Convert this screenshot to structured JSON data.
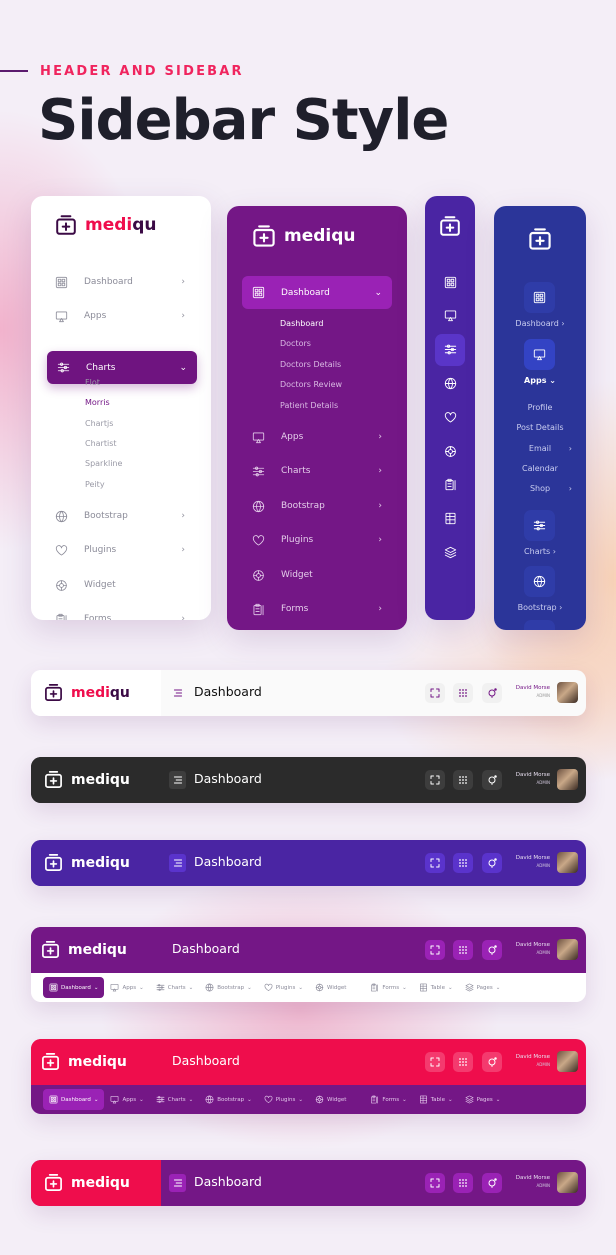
{
  "hero": {
    "kicker": "HEADER AND SIDEBAR",
    "title": "Sidebar Style"
  },
  "brand": {
    "name_a": "medi",
    "name_b": "qu",
    "full": "mediqu"
  },
  "colors": {
    "purple": "#741786",
    "purple_active": "#9a22b5",
    "indigo": "#4a25a3",
    "navy": "#2b3599",
    "red": "#ef0d4c",
    "dark": "#2b2b2b",
    "accent_pink": "#f0245e"
  },
  "sidebar_light": {
    "items": [
      {
        "label": "Dashboard",
        "icon": "dashboard-icon",
        "chev": "›"
      },
      {
        "label": "Apps",
        "icon": "monitor-icon",
        "chev": "›"
      },
      {
        "label": "Charts",
        "icon": "sliders-icon",
        "chev": "⌄",
        "active": true
      },
      {
        "label": "Bootstrap",
        "icon": "globe-icon",
        "chev": "›"
      },
      {
        "label": "Plugins",
        "icon": "heart-icon",
        "chev": "›"
      },
      {
        "label": "Widget",
        "icon": "gear-icon",
        "chev": ""
      },
      {
        "label": "Forms",
        "icon": "clipboard-icon",
        "chev": "›"
      }
    ],
    "submenu": [
      {
        "label": "Flot"
      },
      {
        "label": "Morris",
        "active": true
      },
      {
        "label": "Chartjs"
      },
      {
        "label": "Chartist"
      },
      {
        "label": "Sparkline"
      },
      {
        "label": "Peity"
      }
    ]
  },
  "sidebar_purple": {
    "items": [
      {
        "label": "Dashboard",
        "icon": "dashboard-icon",
        "chev": "⌄",
        "active": true
      },
      {
        "label": "Apps",
        "icon": "monitor-icon",
        "chev": "›"
      },
      {
        "label": "Charts",
        "icon": "sliders-icon",
        "chev": "›"
      },
      {
        "label": "Bootstrap",
        "icon": "globe-icon",
        "chev": "›"
      },
      {
        "label": "Plugins",
        "icon": "heart-icon",
        "chev": "›"
      },
      {
        "label": "Widget",
        "icon": "gear-icon",
        "chev": ""
      },
      {
        "label": "Forms",
        "icon": "clipboard-icon",
        "chev": "›"
      }
    ],
    "submenu": [
      {
        "label": "Dashboard",
        "active": true
      },
      {
        "label": "Doctors"
      },
      {
        "label": "Doctors Details"
      },
      {
        "label": "Doctors Review"
      },
      {
        "label": "Patient Details"
      }
    ]
  },
  "sidebar_mini": {
    "icons": [
      "dashboard-icon",
      "monitor-icon",
      "sliders-icon",
      "globe-icon",
      "heart-icon",
      "gear-icon",
      "clipboard-icon",
      "table-icon",
      "layers-icon"
    ],
    "active_index": 2
  },
  "sidebar_compact": {
    "items": [
      {
        "label": "Dashboard",
        "icon": "dashboard-icon",
        "chev": "›"
      },
      {
        "label": "Apps",
        "icon": "monitor-icon",
        "chev": "⌄",
        "active": true
      },
      {
        "label": "Charts",
        "icon": "sliders-icon",
        "chev": "›"
      },
      {
        "label": "Bootstrap",
        "icon": "globe-icon",
        "chev": "›"
      }
    ],
    "submenu": [
      {
        "label": "Profile",
        "chev": ""
      },
      {
        "label": "Post Details",
        "chev": ""
      },
      {
        "label": "Email",
        "chev": "›"
      },
      {
        "label": "Calendar",
        "chev": ""
      },
      {
        "label": "Shop",
        "chev": "›"
      }
    ]
  },
  "header": {
    "page_title": "Dashboard",
    "user_name": "David Morse",
    "user_role": "ADMIN"
  },
  "nav_items": [
    {
      "label": "Dashboard",
      "icon": "dashboard-icon",
      "active": true
    },
    {
      "label": "Apps",
      "icon": "monitor-icon"
    },
    {
      "label": "Charts",
      "icon": "sliders-icon"
    },
    {
      "label": "Bootstrap",
      "icon": "globe-icon"
    },
    {
      "label": "Plugins",
      "icon": "heart-icon"
    },
    {
      "label": "Widget",
      "icon": "gear-icon",
      "nochev": true
    },
    {
      "label": "Forms",
      "icon": "clipboard-icon"
    },
    {
      "label": "Table",
      "icon": "table-icon"
    },
    {
      "label": "Pages",
      "icon": "layers-icon"
    }
  ],
  "headers": [
    {
      "theme": "light",
      "logo_bg": "#ffffff",
      "bar_bg": "#fafafa",
      "btn_bg": "#f1f1f1",
      "icon_color": "#741786",
      "text": "#111111",
      "nav": false
    },
    {
      "theme": "dark",
      "logo_bg": "#2b2b2b",
      "bar_bg": "#2b2b2b",
      "btn_bg": "#3d3d3d",
      "icon_color": "#ffffff",
      "text": "#ffffff",
      "nav": false
    },
    {
      "theme": "indigo",
      "logo_bg": "#4a25a3",
      "bar_bg": "#4a25a3",
      "btn_bg": "#5a33cc",
      "icon_color": "#ffffff",
      "text": "#ffffff",
      "nav": false
    },
    {
      "theme": "purple-nav-light",
      "logo_bg": "#741786",
      "bar_bg": "#741786",
      "btn_bg": "#9a22b5",
      "icon_color": "#ffffff",
      "text": "#ffffff",
      "nav": true,
      "nav_bg": "#ffffff",
      "nav_text": "#8a8a99",
      "nav_active_bg": "#741786",
      "no_hamburger": true
    },
    {
      "theme": "red-nav-purple",
      "logo_bg": "#ef0d4c",
      "bar_bg": "#ef0d4c",
      "btn_bg": "#f43a6e",
      "icon_color": "#ffffff",
      "text": "#ffffff",
      "nav": true,
      "nav_bg": "#741786",
      "nav_text": "#e2c6ea",
      "nav_active_bg": "#9a22b5",
      "no_hamburger": true
    },
    {
      "theme": "red-purple",
      "logo_bg": "#ef0d4c",
      "bar_bg": "#741786",
      "btn_bg": "#9a22b5",
      "icon_color": "#ffffff",
      "text": "#ffffff",
      "nav": false
    }
  ]
}
